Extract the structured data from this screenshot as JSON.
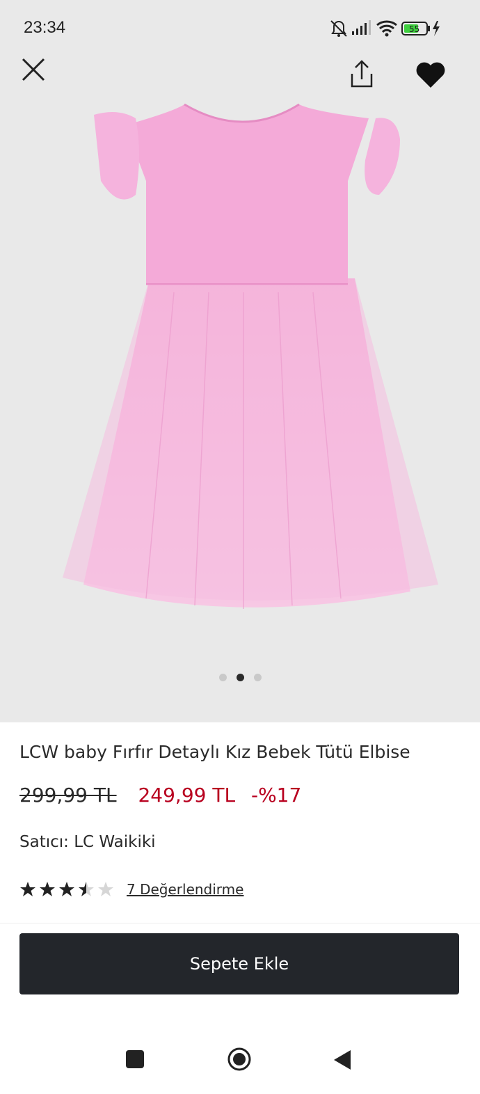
{
  "status_bar": {
    "time": "23:34",
    "battery_level": "55",
    "icons": [
      "mute-bell-icon",
      "signal-icon",
      "wifi-icon",
      "battery-icon",
      "charging-icon"
    ]
  },
  "top_actions": {
    "close_icon": "close-icon",
    "share_icon": "share-icon",
    "favorite_icon": "heart-icon"
  },
  "gallery": {
    "image_count": 3,
    "active_index": 1,
    "image_subject": "pink tutu dress with ruffled sleeves"
  },
  "product": {
    "title": "LCW baby Fırfır Detaylı Kız Bebek Tütü Elbise",
    "old_price": "299,99 TL",
    "new_price": "249,99 TL",
    "discount": "-%17",
    "seller_label": "Satıcı:",
    "seller_name": "LC Waikiki",
    "rating": 3.5,
    "rating_max": 5,
    "reviews_text": "7 Değerlendirme"
  },
  "cart": {
    "button_label": "Sepete Ekle"
  },
  "colors": {
    "hero_bg": "#e9e9e9",
    "price_red": "#b8001f",
    "button_dark": "#23262b",
    "dress_pink": "#f4a8d6"
  },
  "nav_bar": {
    "icons": [
      "recents-square-icon",
      "home-circle-icon",
      "back-triangle-icon"
    ]
  }
}
